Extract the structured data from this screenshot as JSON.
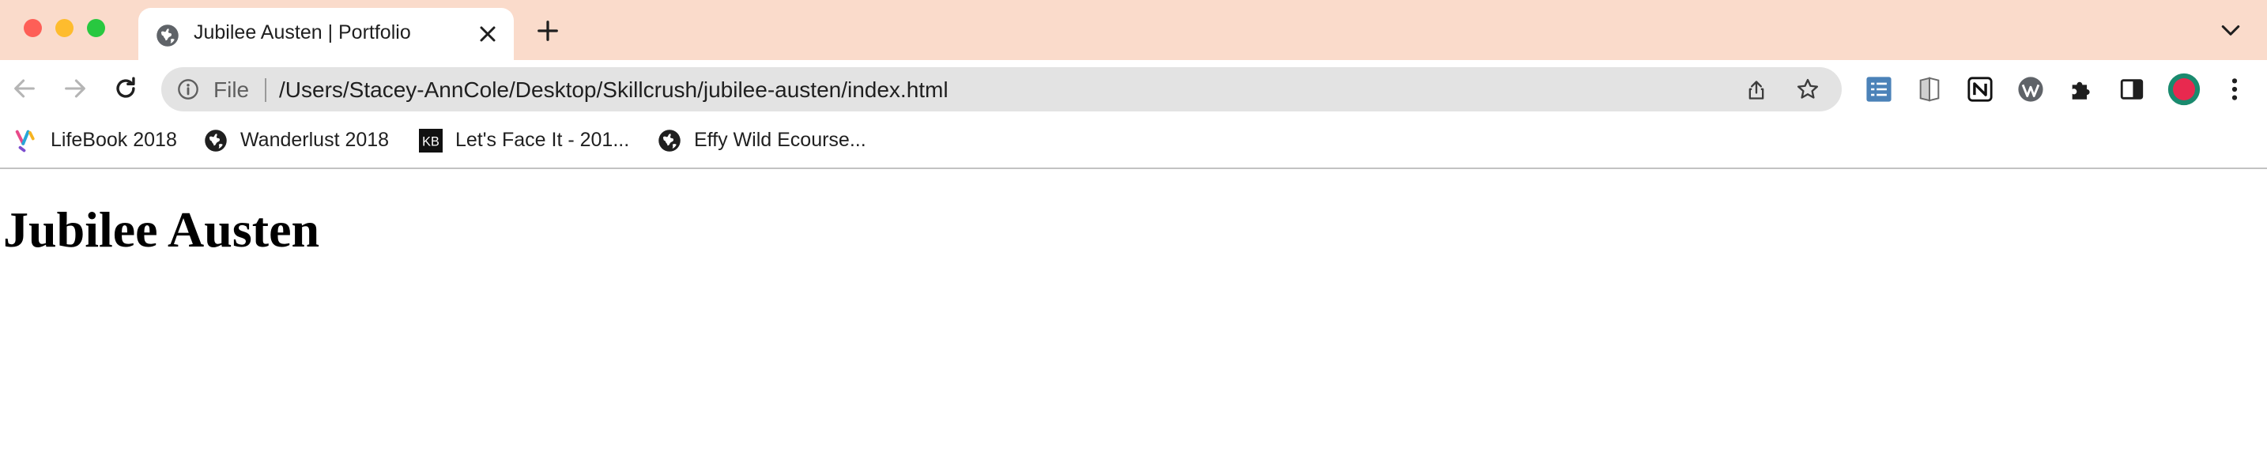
{
  "tab": {
    "title": "Jubilee Austen | Portfolio"
  },
  "toolbar": {
    "scheme_label": "File",
    "url": "/Users/Stacey-AnnCole/Desktop/Skillcrush/jubilee-austen/index.html"
  },
  "bookmarks": [
    {
      "label": "LifeBook 2018",
      "icon": "lifebook-icon"
    },
    {
      "label": "Wanderlust 2018",
      "icon": "globe-icon"
    },
    {
      "label": "Let's Face It - 201...",
      "icon": "kb-icon",
      "icon_text": "KB"
    },
    {
      "label": "Effy Wild Ecourse...",
      "icon": "globe-icon"
    }
  ],
  "extensions": [
    "checklist-icon",
    "book-icon",
    "notion-icon",
    "wordpress-icon",
    "puzzle-icon",
    "side-panel-icon",
    "profile-avatar"
  ],
  "page": {
    "heading": "Jubilee Austen"
  },
  "colors": {
    "tabstrip": "#fadbcb",
    "omnibox": "#e3e3e3",
    "avatar_ring": "#1a8a6e",
    "avatar_fill": "#e8294f",
    "checklist_ext": "#4b82b8"
  }
}
